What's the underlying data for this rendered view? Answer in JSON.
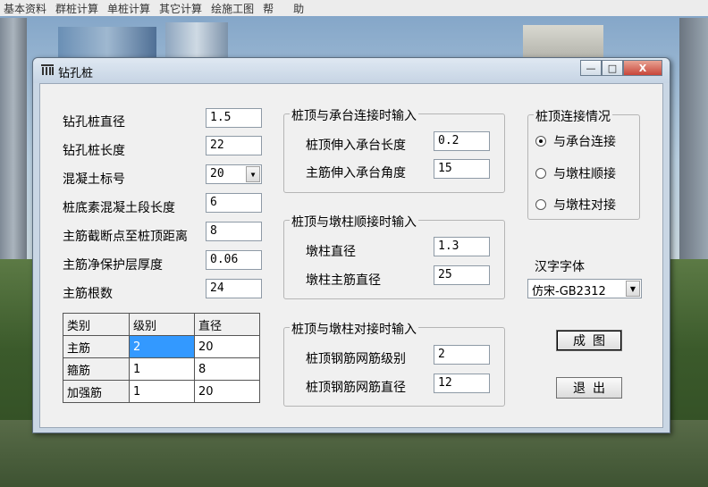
{
  "menubar": {
    "items": [
      "基本资料",
      "群桩计算",
      "单桩计算",
      "其它计算",
      "绘施工图",
      "帮",
      "助"
    ]
  },
  "window": {
    "title": "钻孔桩",
    "icon": "pile-icon",
    "minimize": "—",
    "maximize": "□",
    "close": "X"
  },
  "form": {
    "diameter_label": "钻孔桩直径",
    "diameter_value": "1.5",
    "length_label": "钻孔桩长度",
    "length_value": "22",
    "concrete_label": "混凝土标号",
    "concrete_value": "20",
    "plain_len_label": "桩底素混凝土段长度",
    "plain_len_value": "6",
    "cut_dist_label": "主筋截断点至桩顶距离",
    "cut_dist_value": "8",
    "cover_label": "主筋净保护层厚度",
    "cover_value": "0.06",
    "count_label": "主筋根数",
    "count_value": "24"
  },
  "rebar_table": {
    "headers": [
      "类别",
      "级别",
      "直径"
    ],
    "rows": [
      {
        "name": "主筋",
        "grade": "2",
        "diameter": "20"
      },
      {
        "name": "箍筋",
        "grade": "1",
        "diameter": "8"
      },
      {
        "name": "加强筋",
        "grade": "1",
        "diameter": "20"
      }
    ]
  },
  "cap_group": {
    "title": "桩顶与承台连接时输入",
    "embed_label": "桩顶伸入承台长度",
    "embed_value": "0.2",
    "angle_label": "主筋伸入承台角度",
    "angle_value": "15"
  },
  "pier_smooth_group": {
    "title": "桩顶与墩柱顺接时输入",
    "pier_dia_label": "墩柱直径",
    "pier_dia_value": "1.3",
    "pier_rebar_label": "墩柱主筋直径",
    "pier_rebar_value": "25"
  },
  "pier_butt_group": {
    "title": "桩顶与墩柱对接时输入",
    "mesh_grade_label": "桩顶钢筋网筋级别",
    "mesh_grade_value": "2",
    "mesh_dia_label": "桩顶钢筋网筋直径",
    "mesh_dia_value": "12"
  },
  "connection_group": {
    "title": "桩顶连接情况",
    "options": [
      "与承台连接",
      "与墩柱顺接",
      "与墩柱对接"
    ],
    "selected_index": 0
  },
  "font": {
    "label": "汉字字体",
    "value": "仿宋-GB2312"
  },
  "buttons": {
    "generate": "成图",
    "exit": "退出"
  }
}
